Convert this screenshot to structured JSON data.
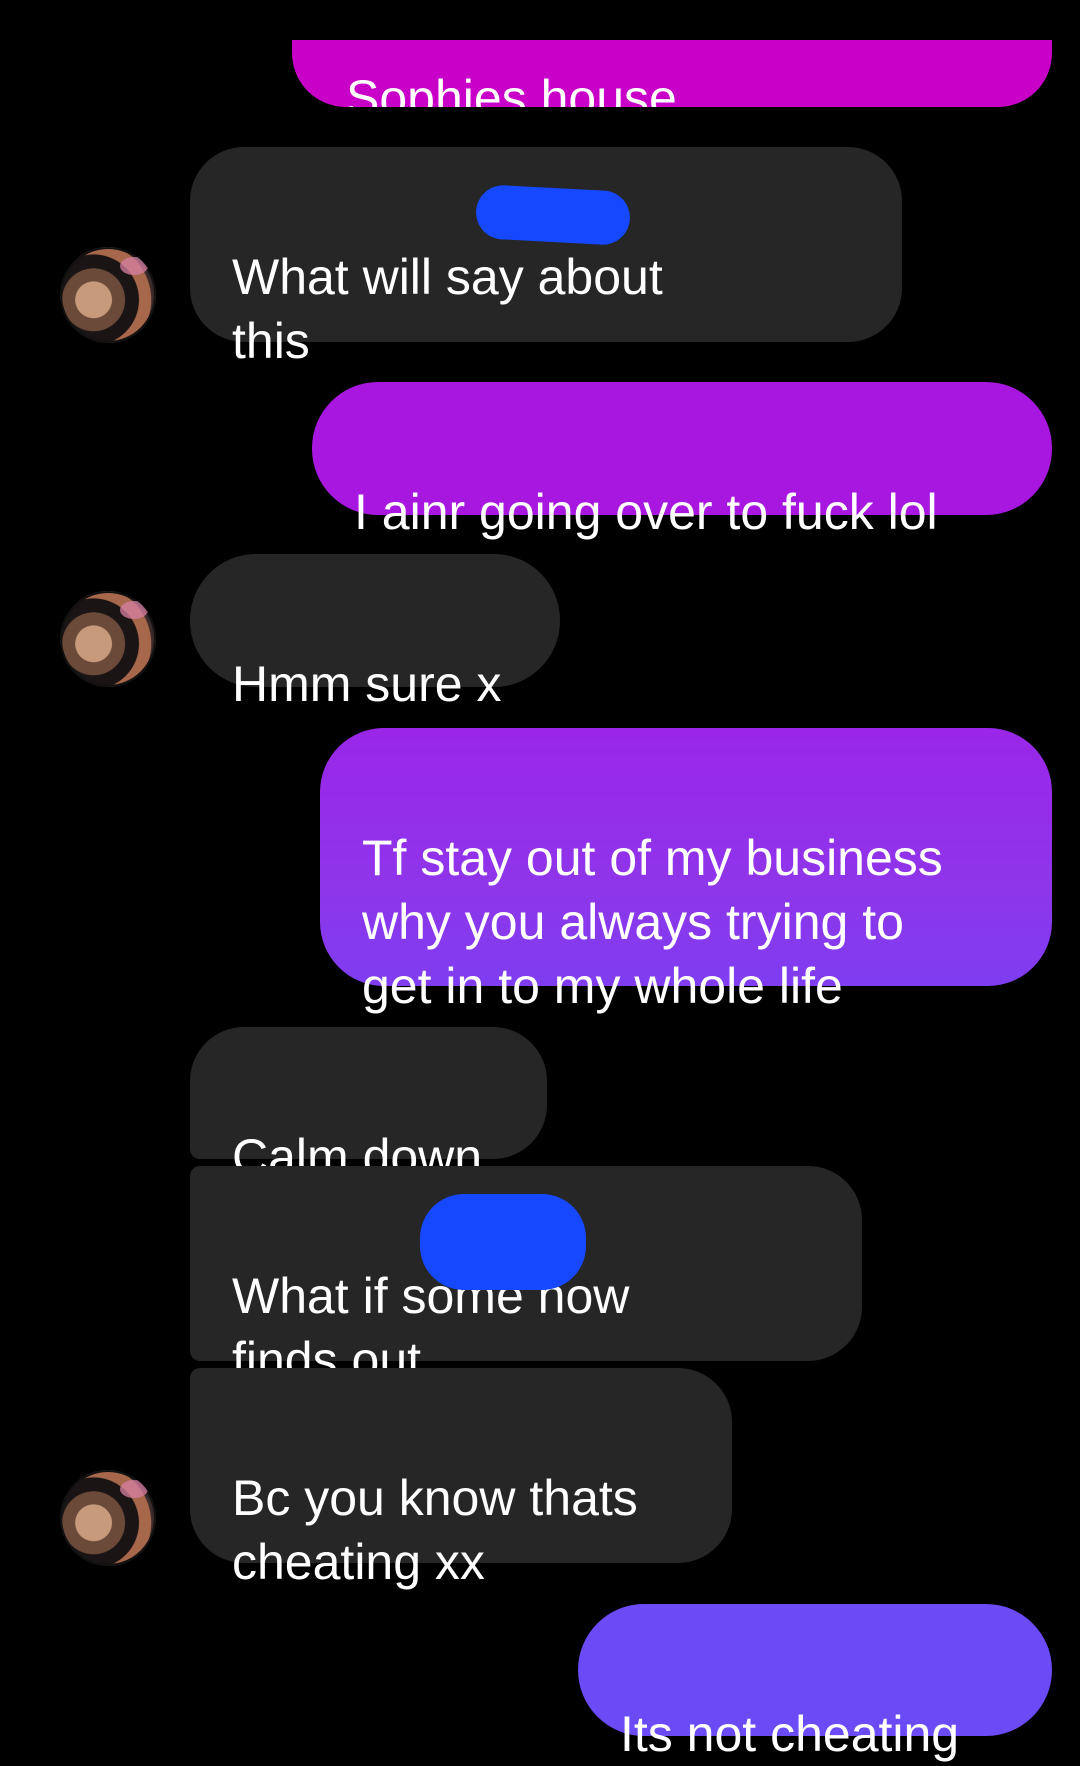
{
  "conversation": {
    "messages": [
      {
        "direction": "outgoing",
        "text": "Sophies house",
        "partially_cut_off": true
      },
      {
        "direction": "incoming",
        "text": "What will  say about\nthis",
        "redacted": true
      },
      {
        "direction": "outgoing",
        "text": "I ainr going over to fuck lol"
      },
      {
        "direction": "incoming",
        "text": "Hmm sure x"
      },
      {
        "direction": "outgoing",
        "text": "Tf stay out of my business\nwhy you always trying to\nget in to my whole life"
      },
      {
        "direction": "incoming",
        "text": "Calm down"
      },
      {
        "direction": "incoming",
        "text": "What if  some how\nfinds out",
        "redacted": true
      },
      {
        "direction": "incoming",
        "text": "Bc you know thats\ncheating xx"
      },
      {
        "direction": "outgoing",
        "text": "Its not cheating"
      }
    ]
  },
  "theme": {
    "background": "#000000",
    "incoming_bubble": "#262626",
    "outgoing_colors": [
      "#c800c8",
      "#a817e0",
      "#8f35ea",
      "#6a4bf5"
    ],
    "redaction": "#1648ff"
  }
}
